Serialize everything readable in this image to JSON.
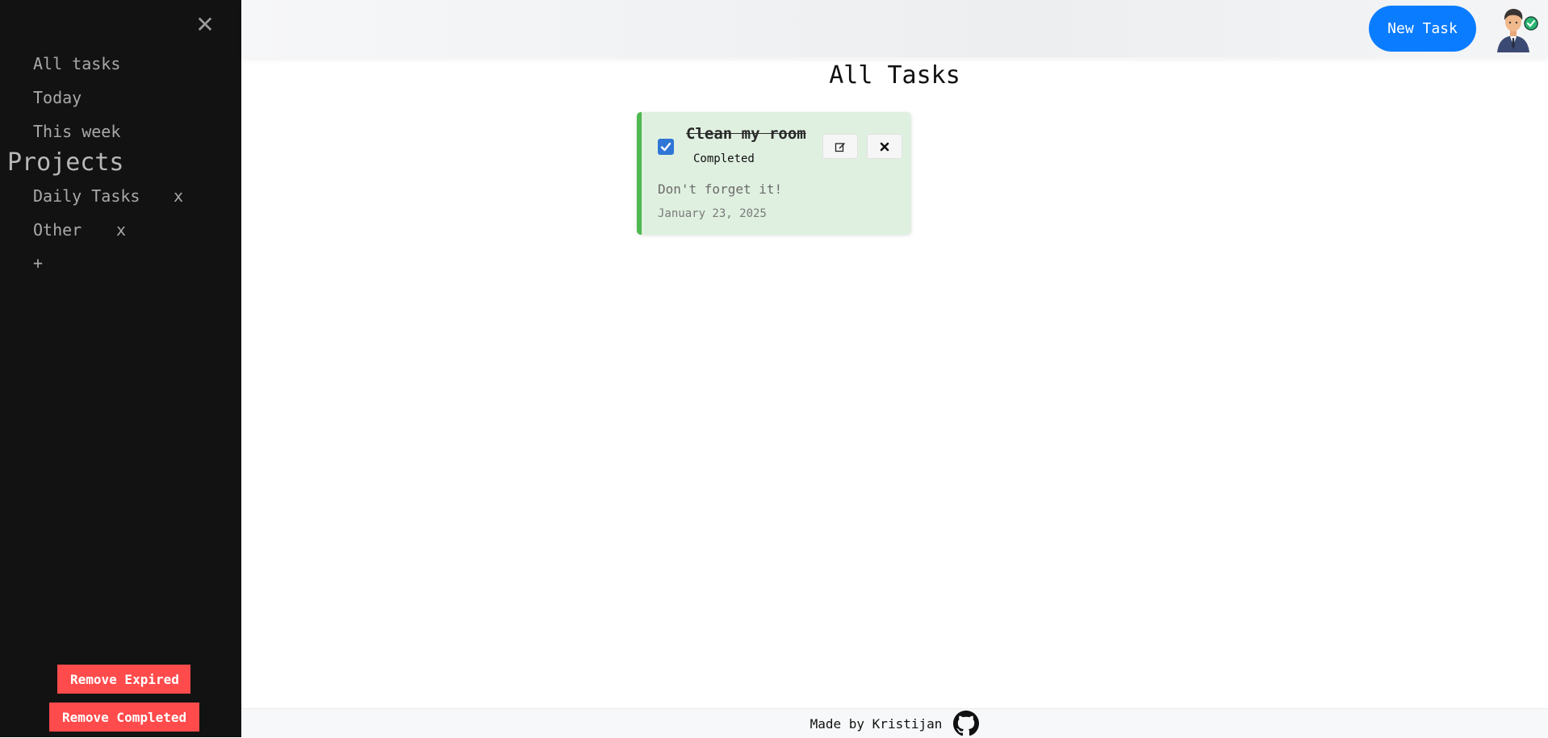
{
  "sidebar": {
    "close_glyph": "✕",
    "nav": [
      {
        "label": "All tasks"
      },
      {
        "label": "Today"
      },
      {
        "label": "This week"
      }
    ],
    "projects_title": "Projects",
    "projects": [
      {
        "name": "Daily Tasks",
        "remove": "x"
      },
      {
        "name": "Other",
        "remove": "x"
      }
    ],
    "add_project": "+",
    "remove_expired_label": "Remove Expired",
    "remove_completed_label": "Remove Completed"
  },
  "header": {
    "new_task_label": "New Task"
  },
  "main": {
    "title": "All Tasks",
    "tasks": [
      {
        "title": "Clean my room",
        "status": "Completed",
        "completed": true,
        "description": "Don't forget it!",
        "date": "January 23, 2025"
      }
    ]
  },
  "footer": {
    "text": "Made by Kristijan"
  },
  "colors": {
    "sidebar_bg": "#121212",
    "accent_blue": "#0a7cff",
    "danger_red": "#ff4b4b",
    "completed_card_bg": "#dff0e0",
    "completed_card_border": "#4fb84f"
  }
}
